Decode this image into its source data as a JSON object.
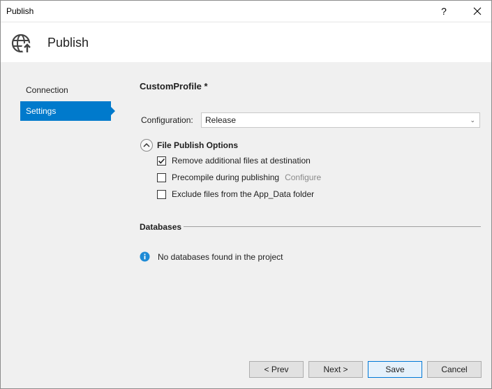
{
  "window": {
    "title": "Publish",
    "help_label": "?"
  },
  "header": {
    "title": "Publish",
    "icon": "globe-publish-icon"
  },
  "nav": {
    "items": [
      {
        "label": "Connection",
        "selected": false
      },
      {
        "label": "Settings",
        "selected": true
      }
    ]
  },
  "main": {
    "profile_title": "CustomProfile *",
    "configuration": {
      "label": "Configuration:",
      "value": "Release"
    },
    "file_publish_options": {
      "title": "File Publish Options",
      "expanded": true,
      "options": [
        {
          "label": "Remove additional files at destination",
          "checked": true
        },
        {
          "label": "Precompile during publishing",
          "checked": false,
          "link": "Configure"
        },
        {
          "label": "Exclude files from the App_Data folder",
          "checked": false
        }
      ]
    },
    "databases": {
      "title": "Databases",
      "message": "No databases found in the project"
    }
  },
  "buttons": {
    "prev": "< Prev",
    "next": "Next >",
    "save": "Save",
    "cancel": "Cancel"
  },
  "colors": {
    "accent": "#007acc",
    "info": "#1e8bd6"
  }
}
